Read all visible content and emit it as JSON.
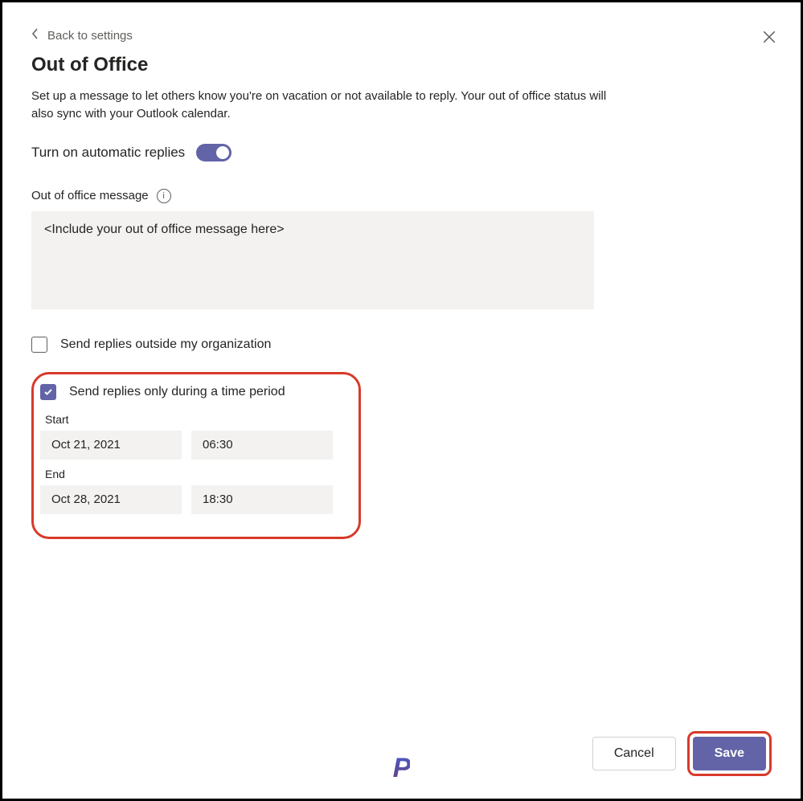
{
  "back_label": "Back to settings",
  "title": "Out of Office",
  "description": "Set up a message to let others know you're on vacation or not available to reply. Your out of office status will also sync with your Outlook calendar.",
  "toggle": {
    "label": "Turn on automatic replies",
    "on": true
  },
  "message": {
    "label": "Out of office message",
    "value": "<Include your out of office message here>"
  },
  "outside_org": {
    "label": "Send replies outside my organization",
    "checked": false
  },
  "time_period": {
    "label": "Send replies only during a time period",
    "checked": true,
    "start_label": "Start",
    "start_date": "Oct 21, 2021",
    "start_time": "06:30",
    "end_label": "End",
    "end_date": "Oct 28, 2021",
    "end_time": "18:30"
  },
  "buttons": {
    "cancel": "Cancel",
    "save": "Save"
  },
  "logo_text": "P"
}
